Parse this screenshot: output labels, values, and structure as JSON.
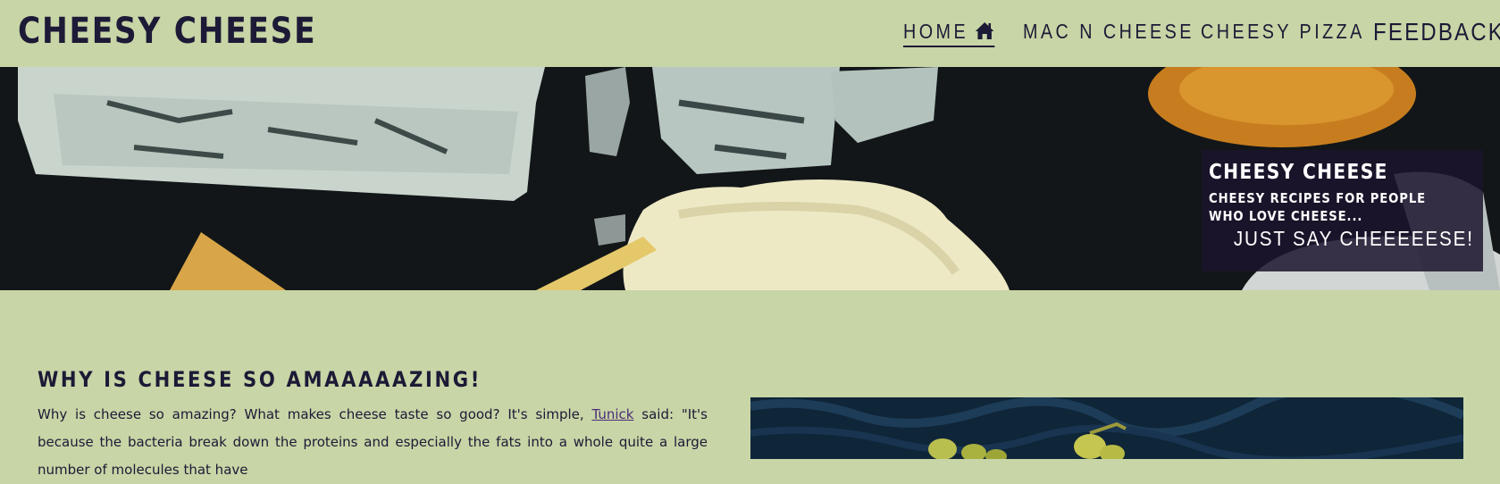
{
  "header": {
    "site_title": "CHEESY CHEESE",
    "nav": {
      "home": "HOME",
      "mac": "MAC N CHEESE",
      "pizza": "CHEESY PIZZA",
      "feedback": "FEEDBACK"
    },
    "home_icon": "home-icon"
  },
  "hero": {
    "title": "CHEESY CHEESE",
    "subtitle": "CHEESY RECIPES FOR PEOPLE WHO LOVE CHEESE...",
    "tagline": "JUST SAY CHEEEEESE!"
  },
  "intro": {
    "heading": "WHY IS CHEESE SO AMAAAAAZING!",
    "text_before": "Why is cheese so amazing? What makes cheese taste so good? It's simple, ",
    "link": "Tunick",
    "text_after": " said: \"It's because the bacteria break down the proteins and especially the fats into a whole quite a large number of molecules that have"
  },
  "colors": {
    "background": "#c8d5a6",
    "text": "#1c1a36",
    "hero_box": "#1c142e"
  }
}
